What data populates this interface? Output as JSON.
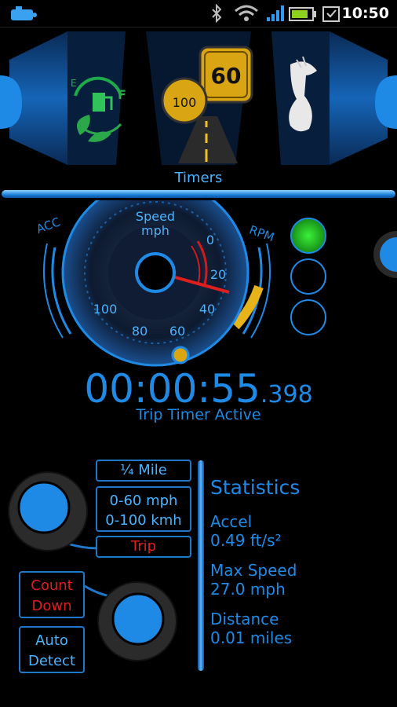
{
  "status": {
    "time": "10:50"
  },
  "header": {
    "title": "Timers",
    "sign_60": "60",
    "sign_100": "100",
    "fuel_e": "E",
    "fuel_f": "F"
  },
  "gauge": {
    "speed_label_1": "Speed",
    "speed_label_2": "mph",
    "acc_label": "ACC",
    "rpm_label": "RPM",
    "ticks": {
      "t0": "0",
      "t20": "20",
      "t40": "40",
      "t60": "60",
      "t80": "80",
      "t100": "100"
    }
  },
  "timer": {
    "main": "00:00:55",
    "ms": ".398",
    "status": "Trip Timer Active"
  },
  "modes": {
    "quarter_mile": "¼ Mile",
    "zero_sixty": "0-60 mph",
    "zero_hundred": "0-100 kmh",
    "trip": "Trip",
    "count_down_1": "Count",
    "count_down_2": "Down",
    "auto_detect_1": "Auto",
    "auto_detect_2": "Detect"
  },
  "stats": {
    "title": "Statistics",
    "accel_label": "Accel",
    "accel_value": "0.49 ft/s²",
    "max_speed_label": "Max Speed",
    "max_speed_value": "27.0 mph",
    "distance_label": "Distance",
    "distance_value": "0.01 miles"
  },
  "colors": {
    "accent": "#1e8ae6",
    "alert": "#e01e1e",
    "light_on": "#2fd12f"
  }
}
